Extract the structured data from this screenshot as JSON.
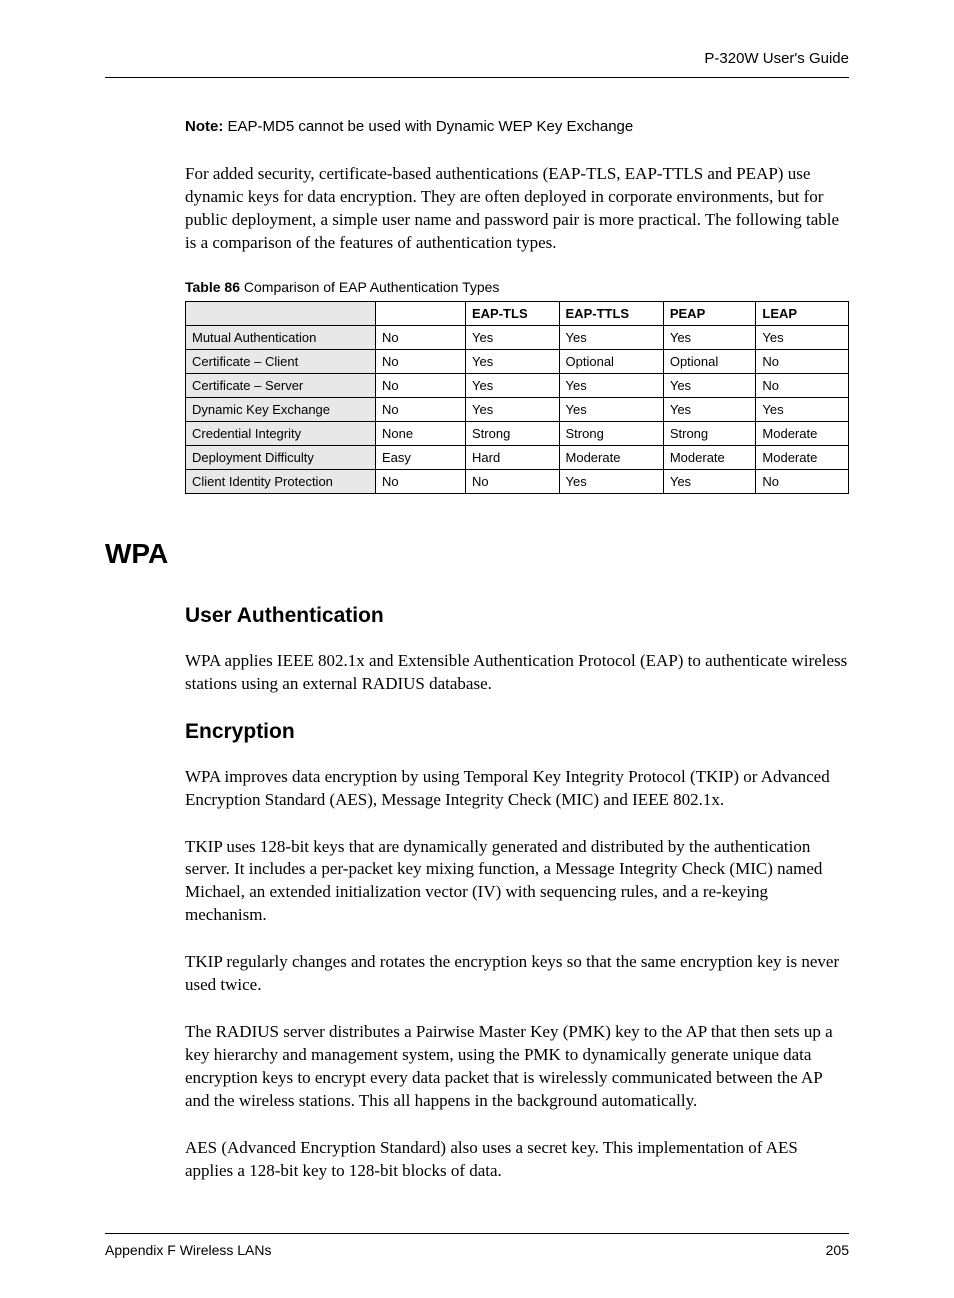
{
  "header": {
    "guide_title": "P-320W User's Guide"
  },
  "note": {
    "label": "Note:",
    "text": " EAP-MD5 cannot be used with Dynamic WEP Key Exchange"
  },
  "intro_para": "For added security, certificate-based authentications (EAP-TLS, EAP-TTLS and PEAP) use dynamic keys for data encryption. They are often deployed in corporate environments, but for public deployment, a simple user name and password pair is more practical. The following table is a comparison of the features of authentication types.",
  "table_caption": {
    "number": "Table 86",
    "title": "   Comparison of EAP Authentication Types"
  },
  "chart_data": {
    "type": "table",
    "columns": [
      "",
      "",
      "EAP-TLS",
      "EAP-TTLS",
      "PEAP",
      "LEAP"
    ],
    "rows": [
      {
        "label": "Mutual Authentication",
        "c1": "No",
        "c2": "Yes",
        "c3": "Yes",
        "c4": "Yes",
        "c5": "Yes"
      },
      {
        "label": "Certificate – Client",
        "c1": "No",
        "c2": "Yes",
        "c3": "Optional",
        "c4": "Optional",
        "c5": "No"
      },
      {
        "label": "Certificate – Server",
        "c1": "No",
        "c2": "Yes",
        "c3": "Yes",
        "c4": "Yes",
        "c5": "No"
      },
      {
        "label": "Dynamic Key Exchange",
        "c1": "No",
        "c2": "Yes",
        "c3": "Yes",
        "c4": "Yes",
        "c5": "Yes"
      },
      {
        "label": "Credential Integrity",
        "c1": "None",
        "c2": "Strong",
        "c3": "Strong",
        "c4": "Strong",
        "c5": "Moderate"
      },
      {
        "label": "Deployment Difficulty",
        "c1": "Easy",
        "c2": "Hard",
        "c3": "Moderate",
        "c4": "Moderate",
        "c5": "Moderate"
      },
      {
        "label": "Client Identity Protection",
        "c1": "No",
        "c2": "No",
        "c3": "Yes",
        "c4": "Yes",
        "c5": "No"
      }
    ]
  },
  "h1_wpa": "WPA",
  "h2_userauth": "User Authentication",
  "para_userauth": "WPA applies IEEE 802.1x and Extensible Authentication Protocol (EAP) to authenticate wireless stations using an external RADIUS database.",
  "h2_encryption": "Encryption",
  "para_enc_1": "WPA improves data encryption by using Temporal Key Integrity Protocol (TKIP) or Advanced Encryption Standard (AES), Message Integrity Check (MIC) and IEEE 802.1x.",
  "para_enc_2": "TKIP uses 128-bit keys that are dynamically generated and distributed by the authentication server. It includes a per-packet key mixing function, a Message Integrity Check (MIC) named Michael, an extended initialization vector (IV) with sequencing rules, and a re-keying mechanism.",
  "para_enc_3": "TKIP regularly changes and rotates the encryption keys so that the same encryption key is never used twice.",
  "para_enc_4": "The RADIUS server distributes a Pairwise Master Key (PMK) key to the AP that then sets up a key hierarchy and management system, using the PMK to dynamically generate unique data encryption keys to encrypt every data packet that is wirelessly communicated between the AP and the wireless stations. This all happens in the background automatically.",
  "para_enc_5": "AES (Advanced Encryption Standard) also uses a secret key. This implementation of AES applies a 128-bit key to 128-bit blocks of data.",
  "footer": {
    "left": "Appendix F Wireless LANs",
    "right": "205"
  }
}
